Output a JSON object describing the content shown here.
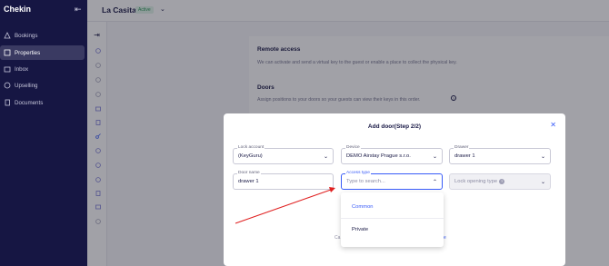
{
  "app": {
    "brand": "Chekin"
  },
  "sidebar": {
    "items": [
      {
        "label": "Bookings",
        "icon": "bookings-icon"
      },
      {
        "label": "Properties",
        "icon": "properties-icon",
        "active": true
      },
      {
        "label": "Inbox",
        "icon": "inbox-icon"
      },
      {
        "label": "Upselling",
        "icon": "upselling-icon"
      },
      {
        "label": "Documents",
        "icon": "documents-icon"
      }
    ]
  },
  "header": {
    "property_name": "La Casita",
    "status": "Active"
  },
  "content": {
    "remote_access": {
      "title": "Remote access",
      "desc": "We can activate and send a virtual key to the guest or enable a place to collect the physical key."
    },
    "doors": {
      "title": "Doors",
      "desc": "Assign positions to your doors so your guests can view their keys in this order."
    }
  },
  "modal": {
    "title": "Add door(Step 2/2)",
    "lock_account": {
      "label": "Lock account",
      "value": "(KeyGuru)"
    },
    "device": {
      "label": "Device",
      "value": "DEMO Airstay Prague s.r.o."
    },
    "drawer": {
      "label": "Drawer",
      "value": "drawer 1"
    },
    "door_name": {
      "label": "Door name",
      "value": "drawer 1"
    },
    "access_type": {
      "label": "Access type",
      "placeholder": "Type to search..."
    },
    "lock_opening_type": {
      "label": "Lock opening type"
    },
    "partial_left": "Ca",
    "partial_right": "e",
    "options": [
      "Common",
      "Private"
    ]
  },
  "colors": {
    "sidebar": "#161643",
    "accent": "#385bf8",
    "annotation": "#e02020"
  }
}
